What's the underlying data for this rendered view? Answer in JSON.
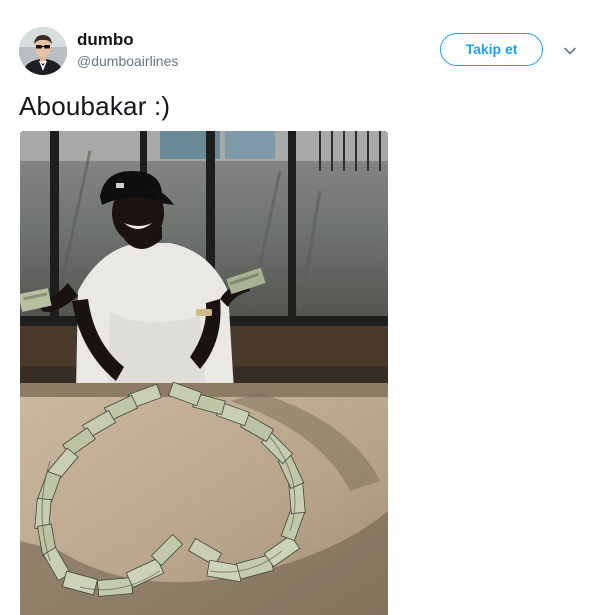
{
  "tweet": {
    "author": {
      "display_name": "dumbo",
      "handle": "@dumboairlines",
      "avatar_icon": "user-avatar"
    },
    "follow_label": "Takip et",
    "menu_icon": "chevron-down-icon",
    "text": "Aboubakar :)",
    "media": {
      "kind": "photo",
      "icon": "tweet-photo"
    }
  },
  "colors": {
    "accent": "#1da1f2",
    "text_primary": "#14171a",
    "text_secondary": "#657786"
  }
}
